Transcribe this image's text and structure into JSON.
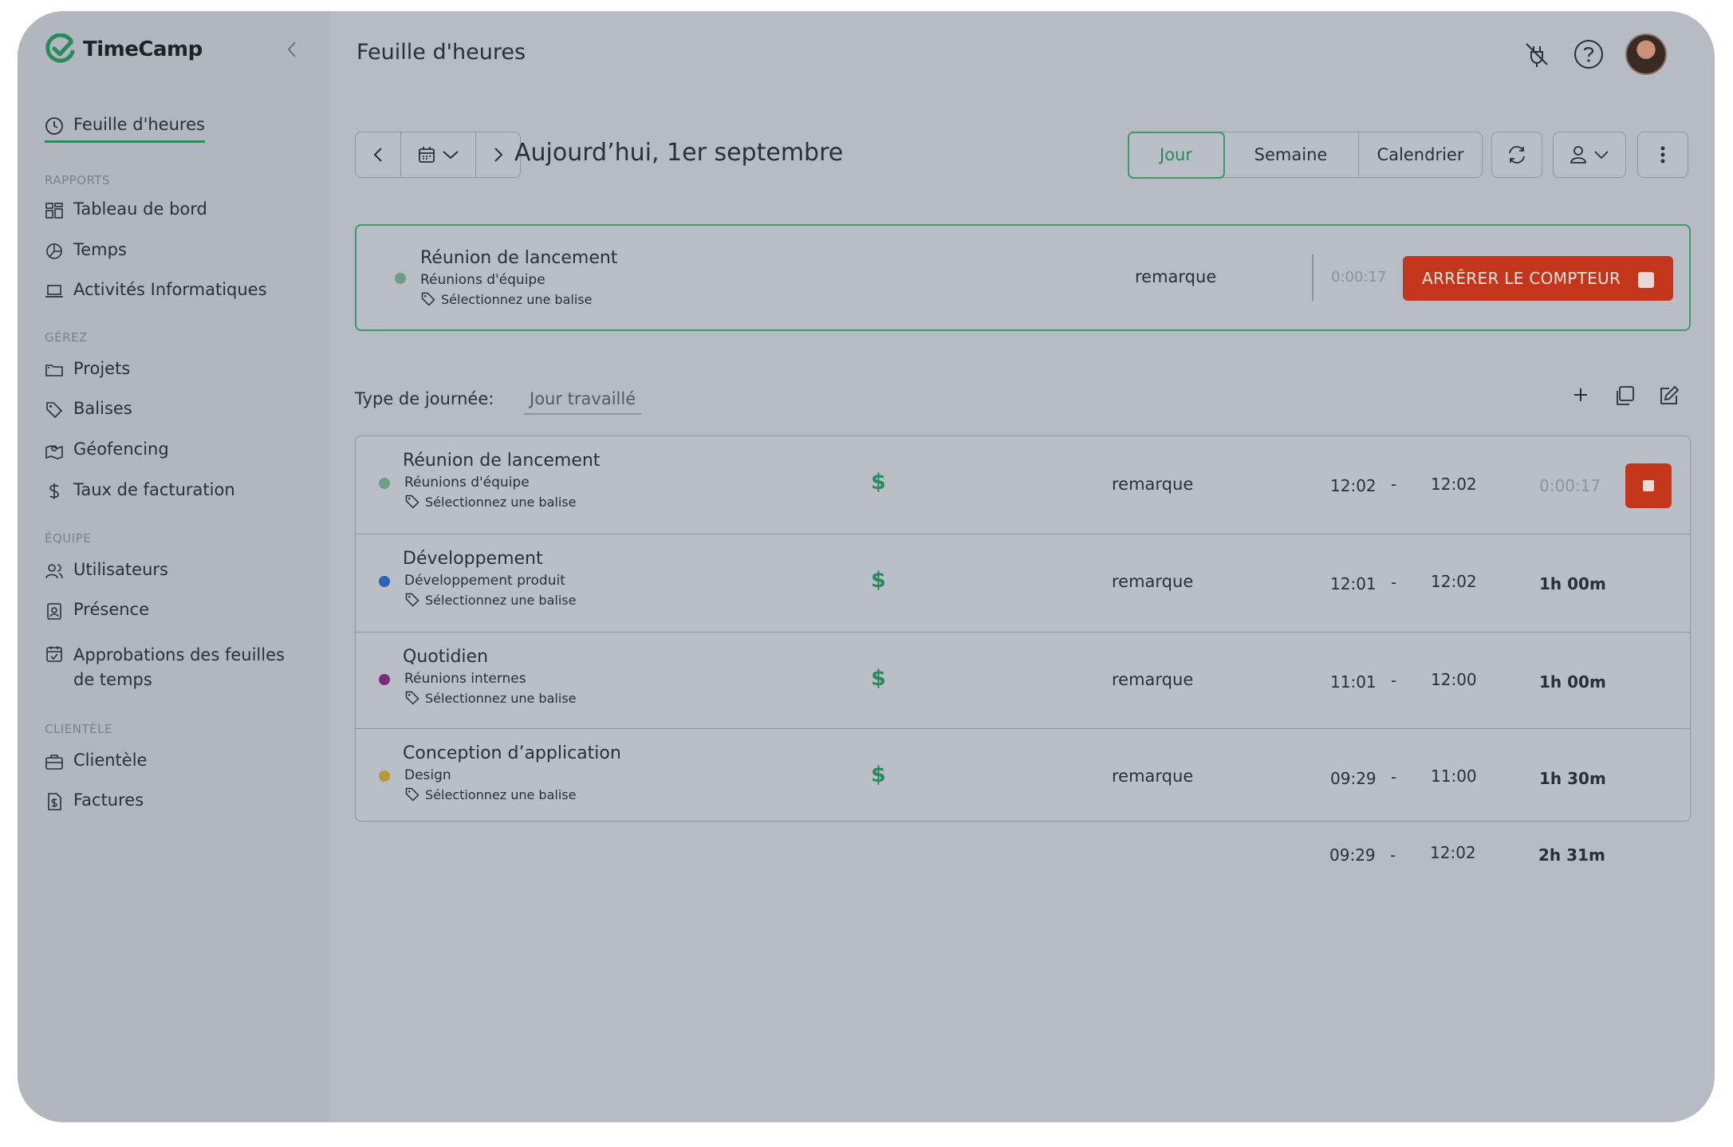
{
  "app": {
    "name": "TimeCamp",
    "brand_color": "#2a8a5a",
    "stop_color": "#c4361c"
  },
  "sidebar": {
    "active_item": "Feuille d'heures",
    "sections": [
      {
        "title": "RAPPORTS",
        "items": [
          "Tableau de bord",
          "Temps",
          "Activités Informatiques"
        ]
      },
      {
        "title": "GÉREZ",
        "items": [
          "Projets",
          "Balises",
          "Géofencing",
          "Taux de facturation"
        ]
      },
      {
        "title": "ÉQUIPE",
        "items": [
          "Utilisateurs",
          "Présence",
          "Approbations des feuilles de temps"
        ]
      },
      {
        "title": "CLIENTÈLE",
        "items": [
          "Clientèle",
          "Factures"
        ]
      }
    ]
  },
  "header": {
    "title": "Feuille d'heures"
  },
  "toolbar": {
    "date_label": "Aujourd’hui, 1er septembre",
    "views": [
      "Jour",
      "Semaine",
      "Calendrier"
    ],
    "active_view": "Jour"
  },
  "timer": {
    "title": "Réunion de lancement",
    "project": "Réunions d'équipe",
    "tag_placeholder": "Sélectionnez une balise",
    "note": "remarque",
    "elapsed": "0:00:17",
    "stop_label": "ARRÊRER LE COMPTEUR",
    "dot_color": "#6d9e86"
  },
  "day_type": {
    "label": "Type de journée:",
    "value": "Jour travaillé"
  },
  "entries": [
    {
      "title": "Réunion de lancement",
      "project": "Réunions d'équipe",
      "tag": "Sélectionnez une balise",
      "billable": "$",
      "note": "remarque",
      "start": "12:02",
      "dash": "-",
      "end": "12:02",
      "duration": "0:00:17",
      "running": true,
      "dot_color": "#6d9e86"
    },
    {
      "title": "Développement",
      "project": "Développement produit",
      "tag": "Sélectionnez une balise",
      "billable": "$",
      "note": "remarque",
      "start": "12:01",
      "dash": "-",
      "end": "12:02",
      "duration": "1h 00m",
      "running": false,
      "dot_color": "#2a64b5"
    },
    {
      "title": "Quotidien",
      "project": "Réunions internes",
      "tag": "Sélectionnez une balise",
      "billable": "$",
      "note": "remarque",
      "start": "11:01",
      "dash": "-",
      "end": "12:00",
      "duration": "1h 00m",
      "running": false,
      "dot_color": "#7a2a78"
    },
    {
      "title": "Conception d’application",
      "project": "Design",
      "tag": "Sélectionnez une balise",
      "billable": "$",
      "note": "remarque",
      "start": "09:29",
      "dash": "-",
      "end": "11:00",
      "duration": "1h 30m",
      "running": false,
      "dot_color": "#b5973a"
    }
  ],
  "totals": {
    "start": "09:29",
    "dash": "-",
    "end": "12:02",
    "duration": "2h 31m"
  }
}
